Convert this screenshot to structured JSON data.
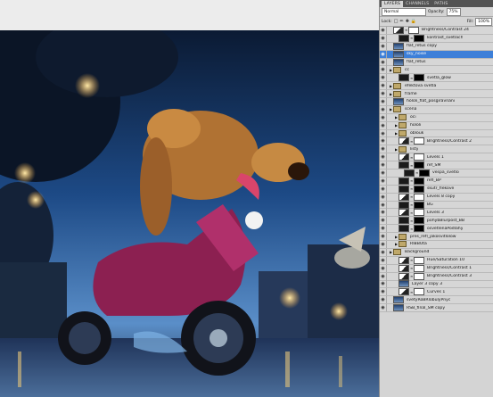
{
  "panel": {
    "tabs": [
      "LAYERS",
      "CHANNELS",
      "PATHS"
    ],
    "blend_mode": "Normal",
    "opacity_label": "Opacity:",
    "opacity_value": "75%",
    "lock_label": "Lock:",
    "fill_label": "Fill:",
    "fill_value": "100%"
  },
  "layers": [
    {
      "name": "Brightness/Contrast 24",
      "indent": 0,
      "type": "adjust",
      "tri": false
    },
    {
      "name": "kontrast_svetlach",
      "indent": 1,
      "type": "masked",
      "tri": false
    },
    {
      "name": "flat_retus copy",
      "indent": 0,
      "type": "pixel",
      "tri": false
    },
    {
      "name": "sky_noise",
      "indent": 0,
      "type": "pixel",
      "tri": false,
      "selected": true
    },
    {
      "name": "flat_retus",
      "indent": 0,
      "type": "pixel",
      "tri": false
    },
    {
      "name": "cc",
      "indent": 0,
      "type": "folder",
      "tri": true
    },
    {
      "name": "svetla_glow",
      "indent": 1,
      "type": "masked",
      "tri": false
    },
    {
      "name": "efektova svetla",
      "indent": 0,
      "type": "folder",
      "tri": true
    },
    {
      "name": "frame",
      "indent": 0,
      "type": "folder",
      "tri": true
    },
    {
      "name": "hololi_flat_posgiravnani",
      "indent": 0,
      "type": "pixel",
      "tri": false
    },
    {
      "name": "scena",
      "indent": 0,
      "type": "folder",
      "tri": true
    },
    {
      "name": "oci",
      "indent": 1,
      "type": "folder",
      "tri": true
    },
    {
      "name": "hololi",
      "indent": 1,
      "type": "folder",
      "tri": true
    },
    {
      "name": "oblouk",
      "indent": 1,
      "type": "folder",
      "tri": true
    },
    {
      "name": "Brightness/Contrast 2",
      "indent": 1,
      "type": "adjust",
      "tri": false
    },
    {
      "name": "listy",
      "indent": 1,
      "type": "folder",
      "tri": true
    },
    {
      "name": "Levels 1",
      "indent": 1,
      "type": "adjust",
      "tri": false
    },
    {
      "name": "ref_SM",
      "indent": 1,
      "type": "masked",
      "tri": false
    },
    {
      "name": "vespa_svetlo",
      "indent": 2,
      "type": "masked",
      "tri": false
    },
    {
      "name": "refl_BP",
      "indent": 1,
      "type": "masked",
      "tri": false
    },
    {
      "name": "skutr_flekove",
      "indent": 1,
      "type": "masked",
      "tri": false
    },
    {
      "name": "Levels 8 copy",
      "indent": 1,
      "type": "adjust",
      "tri": false
    },
    {
      "name": "BG",
      "indent": 1,
      "type": "masked",
      "tri": false
    },
    {
      "name": "Levels 3",
      "indent": 1,
      "type": "adjust",
      "tri": false
    },
    {
      "name": "pohybBlurpost_BB",
      "indent": 1,
      "type": "masked",
      "tri": false
    },
    {
      "name": "osvetlenaPodlahy",
      "indent": 1,
      "type": "masked",
      "tri": false
    },
    {
      "name": "pres_refl_jakosvitlolow",
      "indent": 1,
      "type": "folder",
      "tri": true
    },
    {
      "name": "RIBBUta",
      "indent": 1,
      "type": "folder",
      "tri": true
    },
    {
      "name": "Background",
      "indent": 0,
      "type": "folder",
      "tri": true
    },
    {
      "name": "Hue/Saturation 10",
      "indent": 1,
      "type": "adjust",
      "tri": false
    },
    {
      "name": "Brightness/Contrast 1",
      "indent": 1,
      "type": "adjust",
      "tri": false
    },
    {
      "name": "Brightness/Contrast 3",
      "indent": 1,
      "type": "adjust",
      "tri": false
    },
    {
      "name": "Layer 3 copy 3",
      "indent": 1,
      "type": "pixel",
      "tri": false
    },
    {
      "name": "Curves 1",
      "indent": 1,
      "type": "adjust",
      "tri": false
    },
    {
      "name": "svetyRoBRlobulyPnyc",
      "indent": 0,
      "type": "pixel",
      "tri": false
    },
    {
      "name": "RSB_final_SM copy",
      "indent": 0,
      "type": "pixel",
      "tri": false
    }
  ]
}
